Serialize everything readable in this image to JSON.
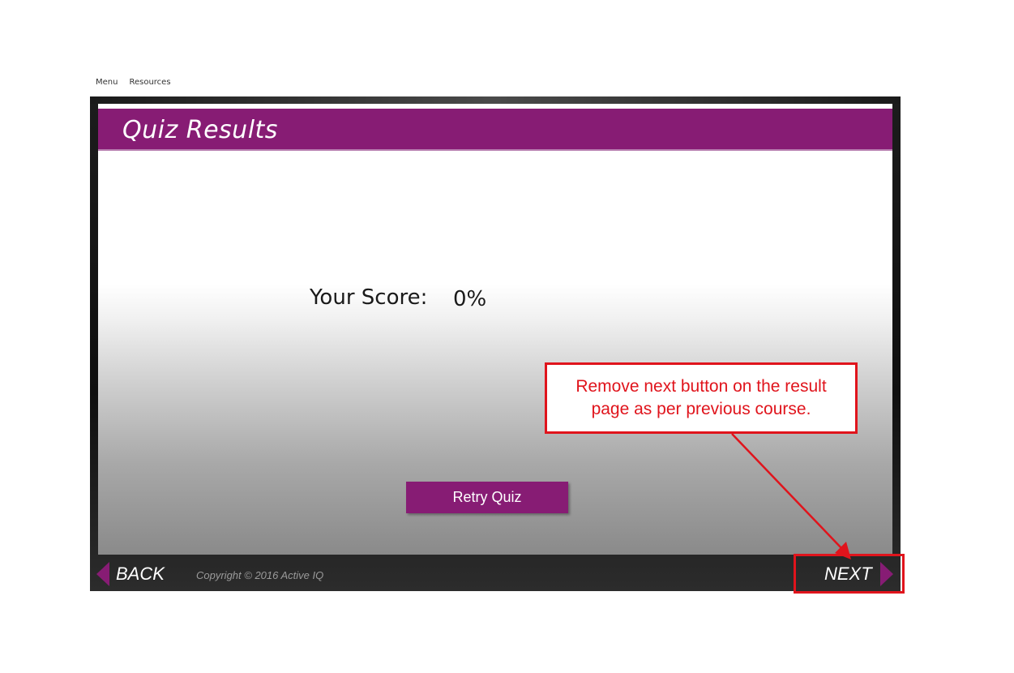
{
  "top_links": {
    "menu": "Menu",
    "resources": "Resources"
  },
  "slide": {
    "title": "Quiz Results",
    "score_label": "Your Score:",
    "score_value": "0%",
    "retry_button": "Retry Quiz"
  },
  "footer": {
    "back_label": "BACK",
    "copyright": "Copyright © 2016 Active IQ",
    "next_label": "NEXT"
  },
  "annotation": {
    "callout_text": "Remove next button on the result page as per previous course."
  },
  "colors": {
    "accent": "#871c74",
    "annotation_red": "#e0141c"
  },
  "icons": {
    "back": "triangle-left-icon",
    "next": "triangle-right-icon",
    "annotation_arrow": "arrow-icon"
  }
}
